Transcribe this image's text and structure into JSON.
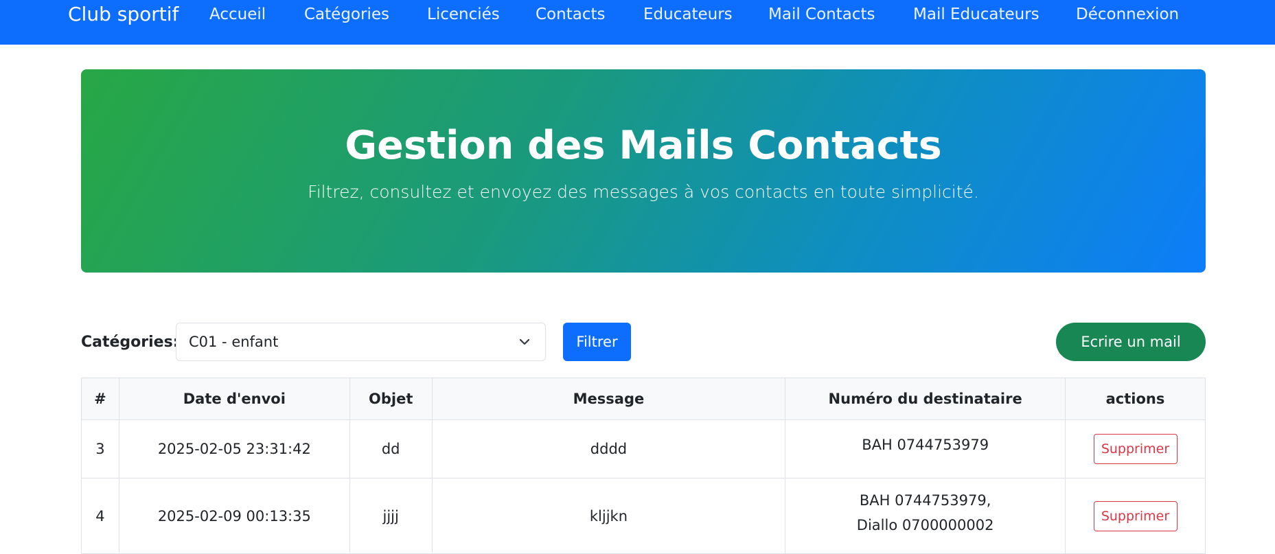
{
  "navbar": {
    "brand": "Club sportif",
    "items": [
      {
        "label": "Accueil"
      },
      {
        "label": "Catégories"
      },
      {
        "label": "Licenciés"
      },
      {
        "label": "Contacts"
      },
      {
        "label": "Educateurs"
      },
      {
        "label": "Mail Contacts"
      },
      {
        "label": "Mail Educateurs"
      },
      {
        "label": "Déconnexion"
      }
    ]
  },
  "hero": {
    "title": "Gestion des Mails Contacts",
    "subtitle": "Filtrez, consultez et envoyez des messages à vos contacts en toute simplicité."
  },
  "filter": {
    "label": "Catégories:",
    "selected": "C01 - enfant",
    "filter_button": "Filtrer",
    "write_button": "Ecrire un mail"
  },
  "table": {
    "headers": [
      "#",
      "Date d'envoi",
      "Objet",
      "Message",
      "Numéro du destinataire",
      "actions"
    ],
    "rows": [
      {
        "id": "3",
        "date": "2025-02-05 23:31:42",
        "subject": "dd",
        "message": "dddd",
        "recipients": [
          "BAH 0744753979"
        ],
        "action": "Supprimer"
      },
      {
        "id": "4",
        "date": "2025-02-09 00:13:35",
        "subject": "jjjj",
        "message": "kljjkn",
        "recipients": [
          "BAH 0744753979,",
          "Diallo 0700000002"
        ],
        "action": "Supprimer"
      }
    ]
  },
  "colors": {
    "primary": "#0d6efd",
    "success": "#198754",
    "danger": "#dc3545",
    "hero_gradient_start": "#28a745",
    "hero_gradient_end": "#0d7dfa"
  }
}
